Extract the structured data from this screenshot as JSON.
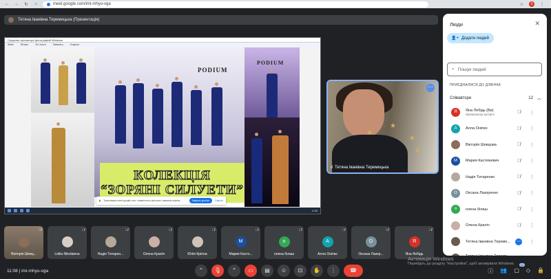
{
  "browser": {
    "url": "meet.google.com/imi-mhyu-vga",
    "profile_initial": "S"
  },
  "presentation": {
    "header": "Тетяна Іванівна Теремецька (Презентація)",
    "window_title": "Средство просмотра фотографий Windows",
    "menu": [
      "Файл",
      "Печать",
      "Эл. почта",
      "Записать",
      "Открыть"
    ],
    "podium_label": "PODIUM",
    "banner_line1": "КОЛЕКЦІЯ",
    "banner_line2": "“ЗОРЯНІ СИЛУЕТИ”",
    "notice": "Трансляция meet.google.com: совместного доступа к вашему экрану.",
    "notice_button": "Закрыть доступ",
    "notice_hide": "Скрыть",
    "taskbar_time": "11:08"
  },
  "presenter": {
    "name": "Тетяна Іванівна Теремецька"
  },
  "people_panel": {
    "title": "Люди",
    "add_button": "Додати людей",
    "search_placeholder": "Пошук людей",
    "section_label": "ПРИЄДНАЛИСЯ ДО ДЗВІНКА",
    "group_label": "Співавтори",
    "group_count": "12",
    "participants": [
      {
        "initial": "Я",
        "name": "Яна Лебідь (Ви)",
        "role": "Організатор зустрічі",
        "color": "#d93025"
      },
      {
        "initial": "А",
        "name": "Алла Оніпко",
        "role": "",
        "color": "#12a4af"
      },
      {
        "initial": "",
        "name": "Вікторія Шевцова",
        "role": "",
        "color": "#8a6d5a"
      },
      {
        "initial": "М",
        "name": "Мария Кастюкевич",
        "role": "",
        "color": "#1a4fa0"
      },
      {
        "initial": "",
        "name": "Надія Титаренко",
        "role": "",
        "color": "#b6a89a"
      },
      {
        "initial": "О",
        "name": "Оксана Лазоренко",
        "role": "",
        "color": "#78909c"
      },
      {
        "initial": "о",
        "name": "олена білаш",
        "role": "",
        "color": "#34a853"
      },
      {
        "initial": "",
        "name": "Олена Краліч",
        "role": "",
        "color": "#c9b0a6"
      },
      {
        "initial": "",
        "name": "Тетяна Іванівна Тереме...",
        "role": "",
        "color": "#6b5a4a"
      },
      {
        "initial": "",
        "name": "Тетяна Іванівна Тереме...",
        "role": "Презентація",
        "color": "#6b5a4a"
      }
    ]
  },
  "tiles": [
    {
      "initial": "",
      "name": "Вікторія Шевц...",
      "color": "#8a6d5a"
    },
    {
      "initial": "",
      "name": "Lidiia Nikolaieva",
      "color": "#d7cfc6"
    },
    {
      "initial": "",
      "name": "Надія Титарен...",
      "color": "#b6a89a"
    },
    {
      "initial": "",
      "name": "Олена Краліч",
      "color": "#c9b0a6"
    },
    {
      "initial": "",
      "name": "Юлія Крігіна",
      "color": "#d0c3b8"
    },
    {
      "initial": "М",
      "name": "Мария Касто...",
      "color": "#1a4fa0"
    },
    {
      "initial": "о",
      "name": "олена білаш",
      "color": "#34a853"
    },
    {
      "initial": "А",
      "name": "Алла Оніпко",
      "color": "#12a4af"
    },
    {
      "initial": "О",
      "name": "Оксана Лазор...",
      "color": "#78909c"
    },
    {
      "initial": "Я",
      "name": "Яна Лебідь",
      "color": "#d93025"
    }
  ],
  "bottom": {
    "time_code": "11:08 | imi-mhyu-vga",
    "people_badge": "12"
  },
  "watermark": {
    "line1": "Активація Windows",
    "line2": "Перейдіть до розділу \"Настройки\", щоб активувати Windows."
  }
}
